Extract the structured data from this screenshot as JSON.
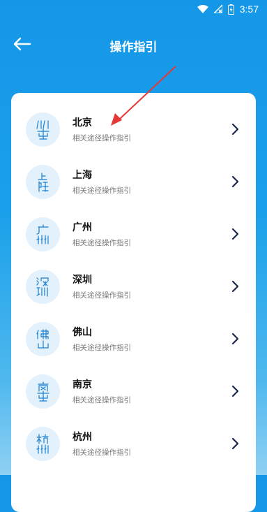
{
  "status_bar": {
    "time": "3:57"
  },
  "header": {
    "title": "操作指引"
  },
  "list": [
    {
      "city": "北京",
      "subtitle": "相关途径操作指引"
    },
    {
      "city": "上海",
      "subtitle": "相关途径操作指引"
    },
    {
      "city": "广州",
      "subtitle": "相关途径操作指引"
    },
    {
      "city": "深圳",
      "subtitle": "相关途径操作指引"
    },
    {
      "city": "佛山",
      "subtitle": "相关途径操作指引"
    },
    {
      "city": "南京",
      "subtitle": "相关途径操作指引"
    },
    {
      "city": "杭州",
      "subtitle": "相关途径操作指引"
    }
  ],
  "icons": {
    "back": "arrow-left-icon",
    "chevron": "chevron-right-icon",
    "badge": "seal-script-emblem"
  },
  "colors": {
    "header_bg": "#1597e8",
    "accent": "#1a7fcf",
    "badge_bg": "#e2f1fb",
    "chevron": "#1a2a4a",
    "annotation": "#e53935"
  }
}
